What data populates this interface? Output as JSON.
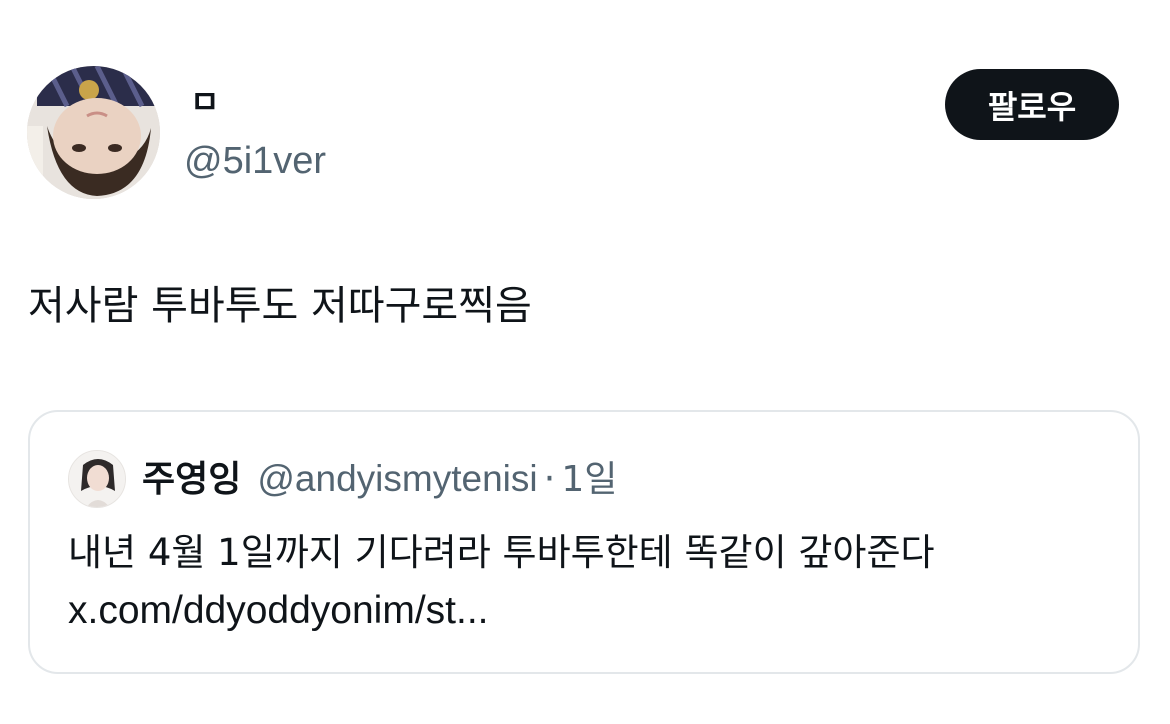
{
  "tweet": {
    "author": {
      "display_name": "ㅁ",
      "handle": "@5i1ver",
      "avatar_icon": "profile-avatar-icon"
    },
    "follow_label": "팔로우",
    "text": "저사람 투바투도 저따구로찍음"
  },
  "quote": {
    "author": {
      "display_name": "주영잉",
      "handle": "@andyismytenisi",
      "avatar_icon": "quoted-profile-avatar-icon"
    },
    "separator": "·",
    "time": "1일",
    "text_line1": "내년 4월 1일까지 기다려라 투바투한테 똑같이 갚아준다",
    "text_line2": "x.com/ddyoddyonim/st..."
  },
  "colors": {
    "text_primary": "#0f1419",
    "text_secondary": "#536471",
    "follow_bg": "#0f1419",
    "card_border": "#e3e7ea"
  }
}
